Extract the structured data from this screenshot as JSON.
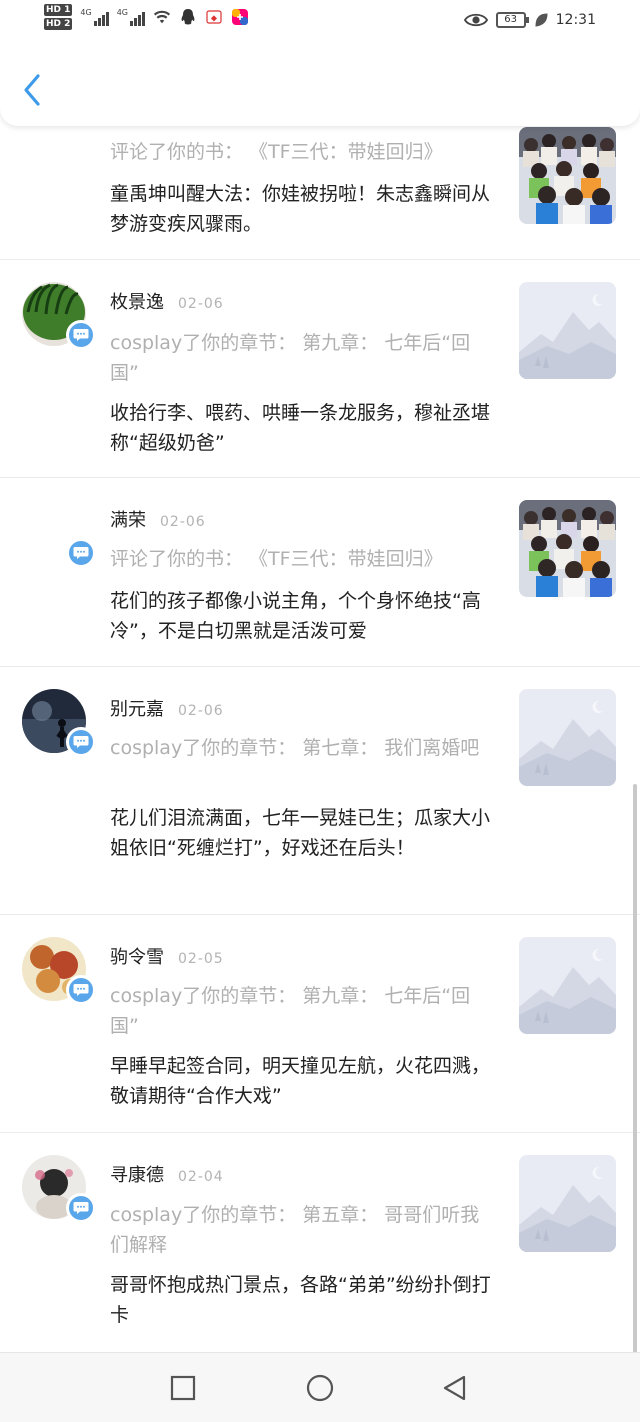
{
  "status_bar": {
    "sim1": "HD 1",
    "sim2": "HD 2",
    "net1": "4G",
    "net2": "4G",
    "battery": "63",
    "time": "12:31",
    "icons": [
      "signal-icon",
      "wifi-icon",
      "qq-icon",
      "app-notification-icon",
      "eye-comfort-icon",
      "battery-icon",
      "leaf-icon"
    ]
  },
  "header": {
    "back_icon": "chevron-left-icon"
  },
  "colors": {
    "accent": "#3d9be9",
    "badge": "#5aa6ea",
    "text_primary": "#222222",
    "text_secondary": "#b0b0b0"
  },
  "items": [
    {
      "name": "",
      "date": "",
      "action": "评论了你的书：  《TF三代：带娃回归》",
      "content": "童禹坤叫醒大法：你娃被拐啦！朱志鑫瞬间从梦游变疾风骤雨。"
    },
    {
      "name": "枚景逸",
      "date": "02-06",
      "action": "cosplay了你的章节：  第九章：  七年后“回国”",
      "content": "收拾行李、喂药、哄睡一条龙服务，穆祉丞堪称“超级奶爸”"
    },
    {
      "name": "满荣",
      "date": "02-06",
      "action": "评论了你的书：  《TF三代：带娃回归》",
      "content": "花们的孩子都像小说主角，个个身怀绝技“高冷”，不是白切黑就是活泼可爱"
    },
    {
      "name": "别元嘉",
      "date": "02-06",
      "action": "cosplay了你的章节：  第七章：  我们离婚吧",
      "content": "花儿们泪流满面，七年一晃娃已生；瓜家大小姐依旧“死缠烂打”，好戏还在后头！"
    },
    {
      "name": "驹令雪",
      "date": "02-05",
      "action": "cosplay了你的章节：  第九章：  七年后“回国”",
      "content": "早睡早起签合同，明天撞见左航，火花四溅，敬请期待“合作大戏”"
    },
    {
      "name": "寻康德",
      "date": "02-04",
      "action": "cosplay了你的章节：  第五章：  哥哥们听我们解释",
      "content": "哥哥怀抱成热门景点，各路“弟弟”纷纷扑倒打卡"
    }
  ],
  "nav": {
    "recents_icon": "square-icon",
    "home_icon": "circle-icon",
    "back_icon": "triangle-back-icon"
  }
}
